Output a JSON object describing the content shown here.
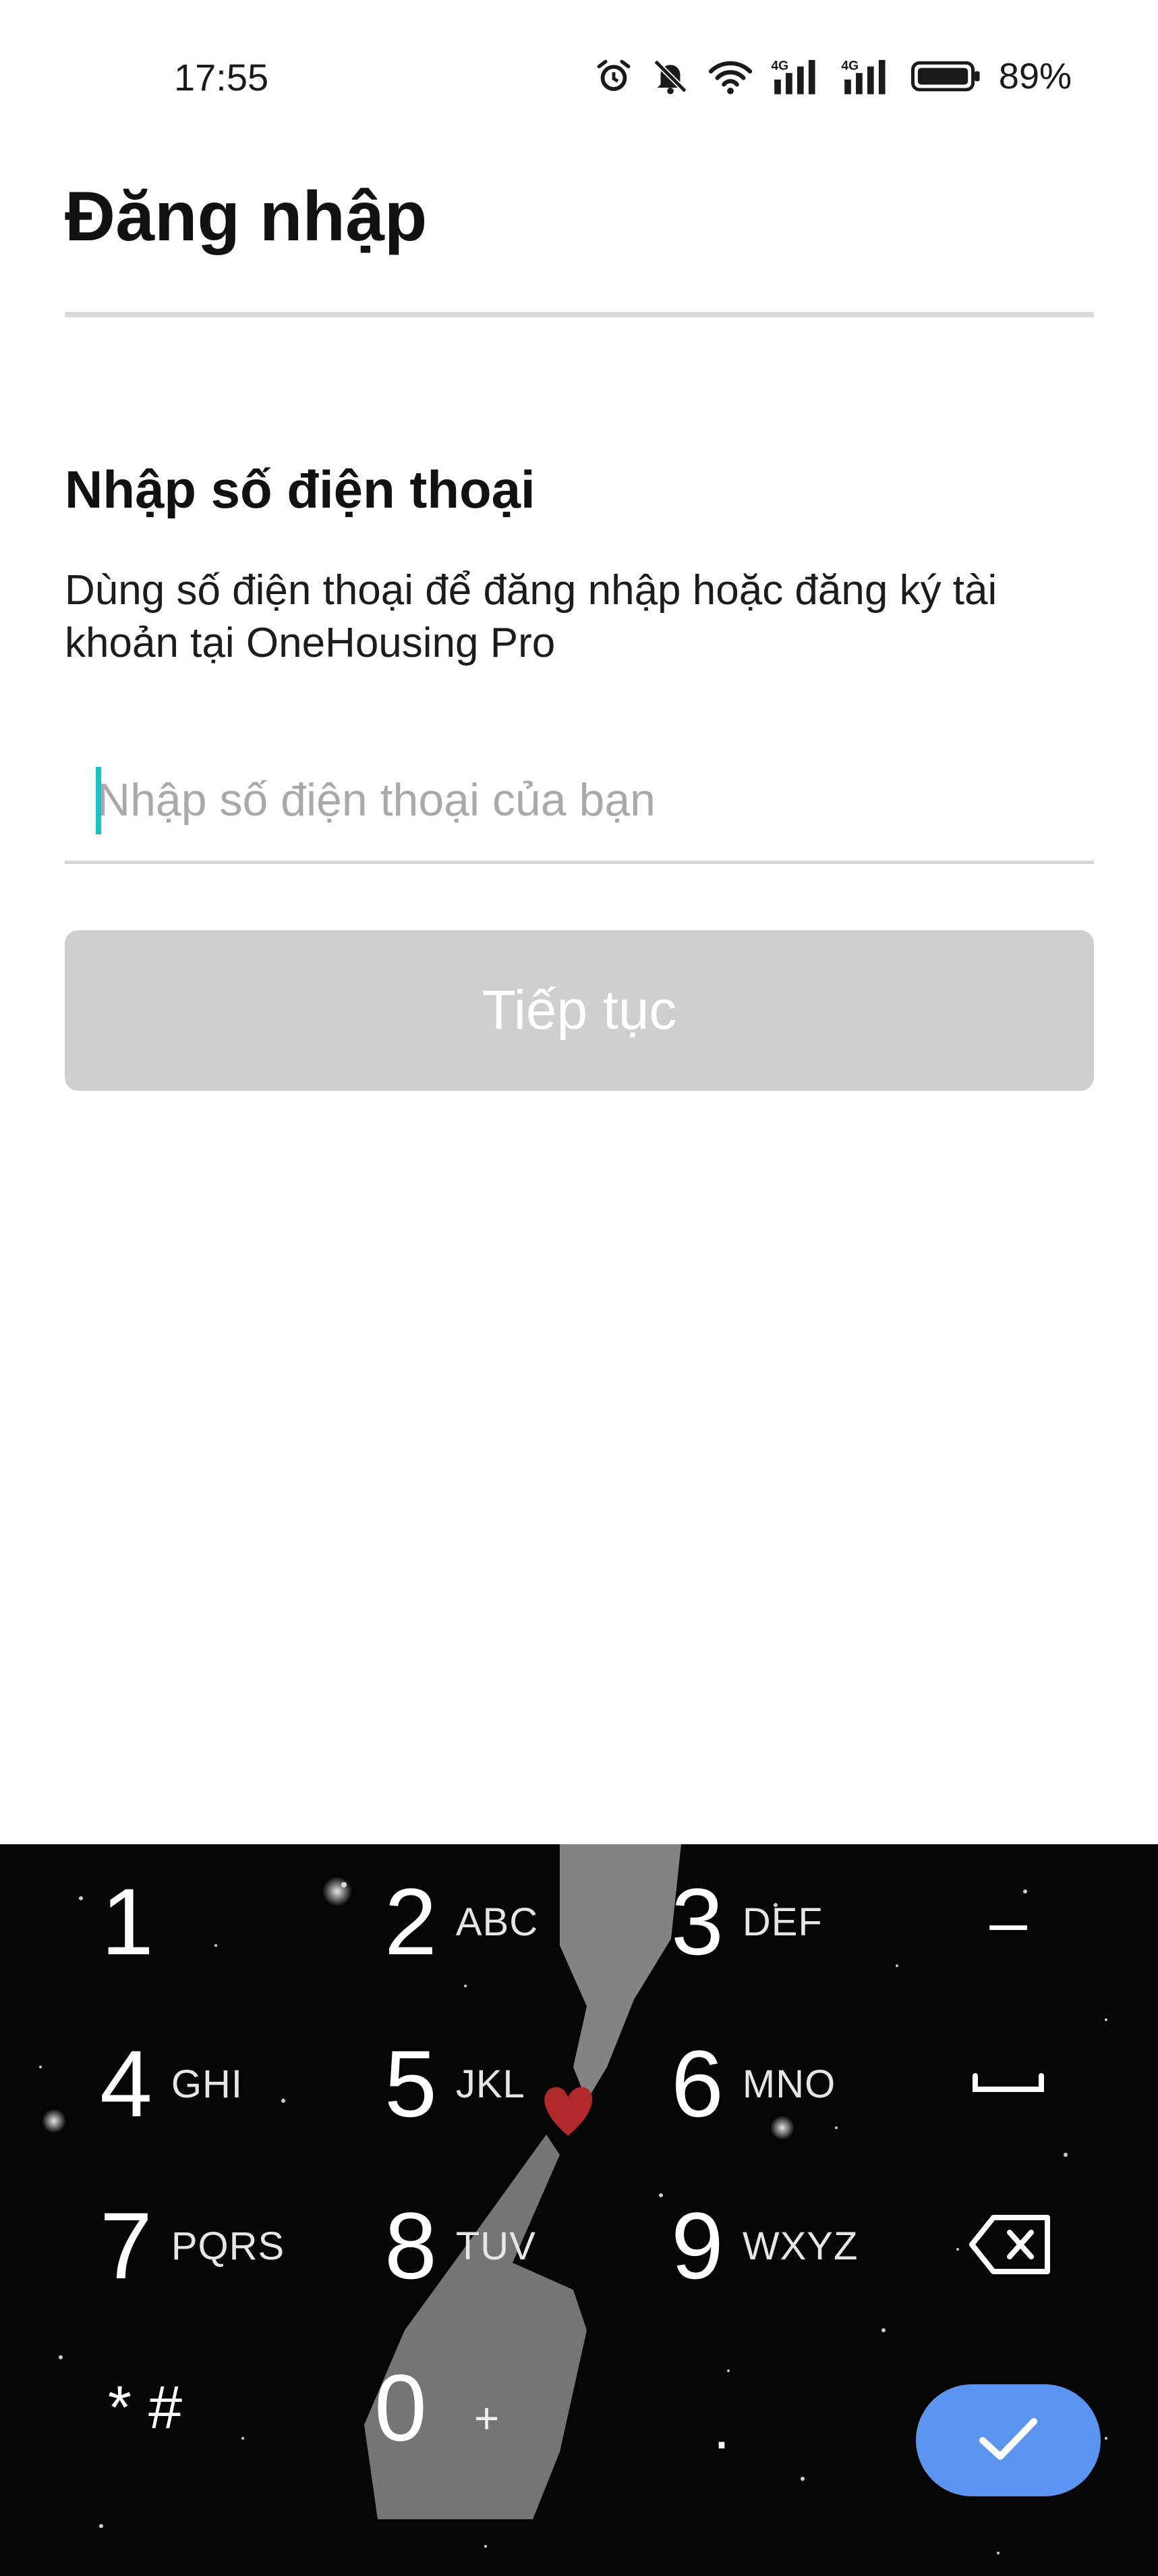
{
  "status_bar": {
    "time": "17:55",
    "battery_percent": "89%",
    "icons": [
      "alarm-icon",
      "bell-off-icon",
      "wifi-icon",
      "signal-4g-icon",
      "signal-4g-icon",
      "battery-icon"
    ],
    "network_label": "4G"
  },
  "header": {
    "title": "Đăng nhập"
  },
  "main": {
    "section_title": "Nhập số điện thoại",
    "description": "Dùng số điện thoại để đăng nhập hoặc đăng ký tài khoản tại OneHousing Pro",
    "phone_input": {
      "value": "",
      "placeholder": "Nhập số điện thoại của bạn"
    },
    "continue_label": "Tiếp tục"
  },
  "keyboard": {
    "keys": [
      {
        "num": "1",
        "letters": ""
      },
      {
        "num": "2",
        "letters": "ABC"
      },
      {
        "num": "3",
        "letters": "DEF"
      },
      {
        "num": "4",
        "letters": "GHI"
      },
      {
        "num": "5",
        "letters": "JKL"
      },
      {
        "num": "6",
        "letters": "MNO"
      },
      {
        "num": "7",
        "letters": "PQRS"
      },
      {
        "num": "8",
        "letters": "TUV"
      },
      {
        "num": "9",
        "letters": "WXYZ"
      },
      {
        "num": "0",
        "letters": "+"
      }
    ],
    "star_hash": "* #",
    "dash": "–",
    "dot": ".",
    "icons": [
      "space-icon",
      "backspace-icon",
      "check-icon"
    ],
    "colors": {
      "confirm": "#5b95f0",
      "background": "#050505"
    }
  },
  "colors": {
    "caret": "#19c3c9",
    "button_disabled": "#cfcfcf",
    "divider": "#d9d9d9"
  }
}
